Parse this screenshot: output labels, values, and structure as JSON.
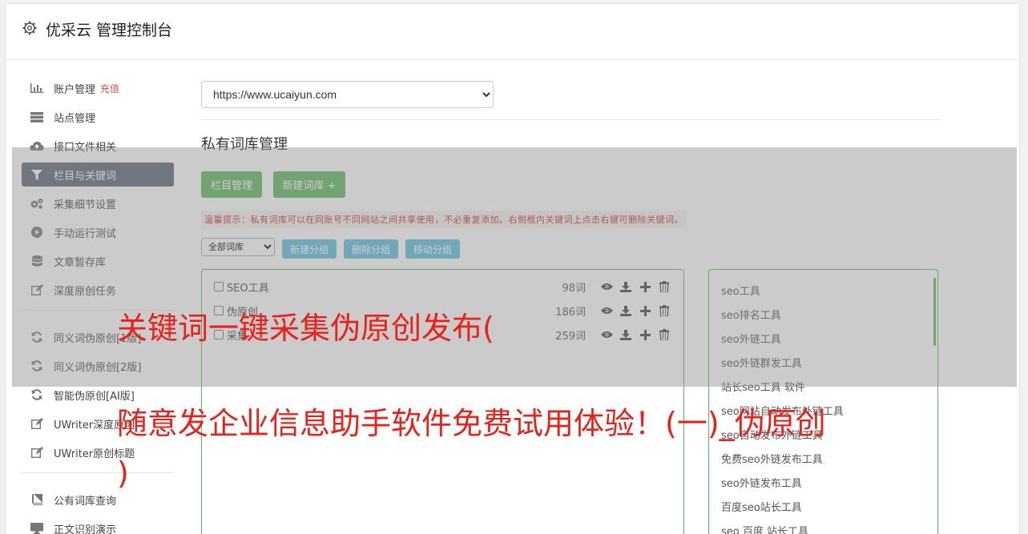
{
  "header": {
    "title": "优采云 管理控制台"
  },
  "sidebar": {
    "items": [
      {
        "label": "账户管理",
        "badge": "充值",
        "icon": "bar-chart-icon"
      },
      {
        "label": "站点管理",
        "icon": "server-icon"
      },
      {
        "label": "接口文件相关",
        "icon": "cloud-upload-icon"
      },
      {
        "label": "栏目与关键词",
        "icon": "filter-icon",
        "active": true
      },
      {
        "label": "采集细节设置",
        "icon": "gears-icon"
      },
      {
        "label": "手动运行测试",
        "icon": "play-circle-icon"
      },
      {
        "label": "文章暂存库",
        "icon": "database-icon"
      },
      {
        "label": "深度原创任务",
        "icon": "edit-icon"
      },
      {
        "label": "同义词伪原创[1版]",
        "icon": "refresh-icon"
      },
      {
        "label": "同义词伪原创[2版]",
        "icon": "refresh-icon"
      },
      {
        "label": "智能伪原创[AI版]",
        "icon": "refresh-icon"
      },
      {
        "label": "UWriter深度原创",
        "icon": "edit-icon"
      },
      {
        "label": "UWriter原创标题",
        "icon": "edit-icon"
      },
      {
        "label": "公有词库查询",
        "icon": "book-icon"
      },
      {
        "label": "正文识别演示",
        "icon": "monitor-icon"
      }
    ]
  },
  "main": {
    "site_select": "https://www.ucaiyun.com",
    "section_title": "私有词库管理",
    "btn_column": "栏目管理",
    "btn_new_lib": "新建词库 +",
    "tip": "温馨提示：私有词库可以在同账号不同网站之间共享使用，不必重复添加。右侧框内关键词上点击右键可删除关键词。",
    "group_select": "全部词库",
    "btn_new_group": "新建分组",
    "btn_delete_group": "删除分组",
    "btn_move_group": "移动分组",
    "libraries": [
      {
        "name": "SEO工具",
        "count": "98词"
      },
      {
        "name": "伪原创",
        "count": "186词"
      },
      {
        "name": "采集",
        "count": "259词"
      }
    ],
    "keywords": [
      "seo工具",
      "seo排名工具",
      "seo外链工具",
      "seo外链群发工具",
      "站长seo工具 软件",
      "seo网站自动发布外链工具",
      "seo自动发布外链工具",
      "免费seo外链发布工具",
      "seo外链发布工具",
      "百度seo站长工具",
      "seo 百度 站长工具"
    ]
  },
  "overlay": {
    "line1": "关键词一键采集伪原创发布(",
    "line2": "随意发企业信息助手软件免费试用体验！(一)_伪原创",
    "line3": ")"
  },
  "colors": {
    "green": "#5cb85c",
    "blue": "#5bc0de",
    "active_nav": "#5a6673",
    "headline": "#e8211b"
  }
}
